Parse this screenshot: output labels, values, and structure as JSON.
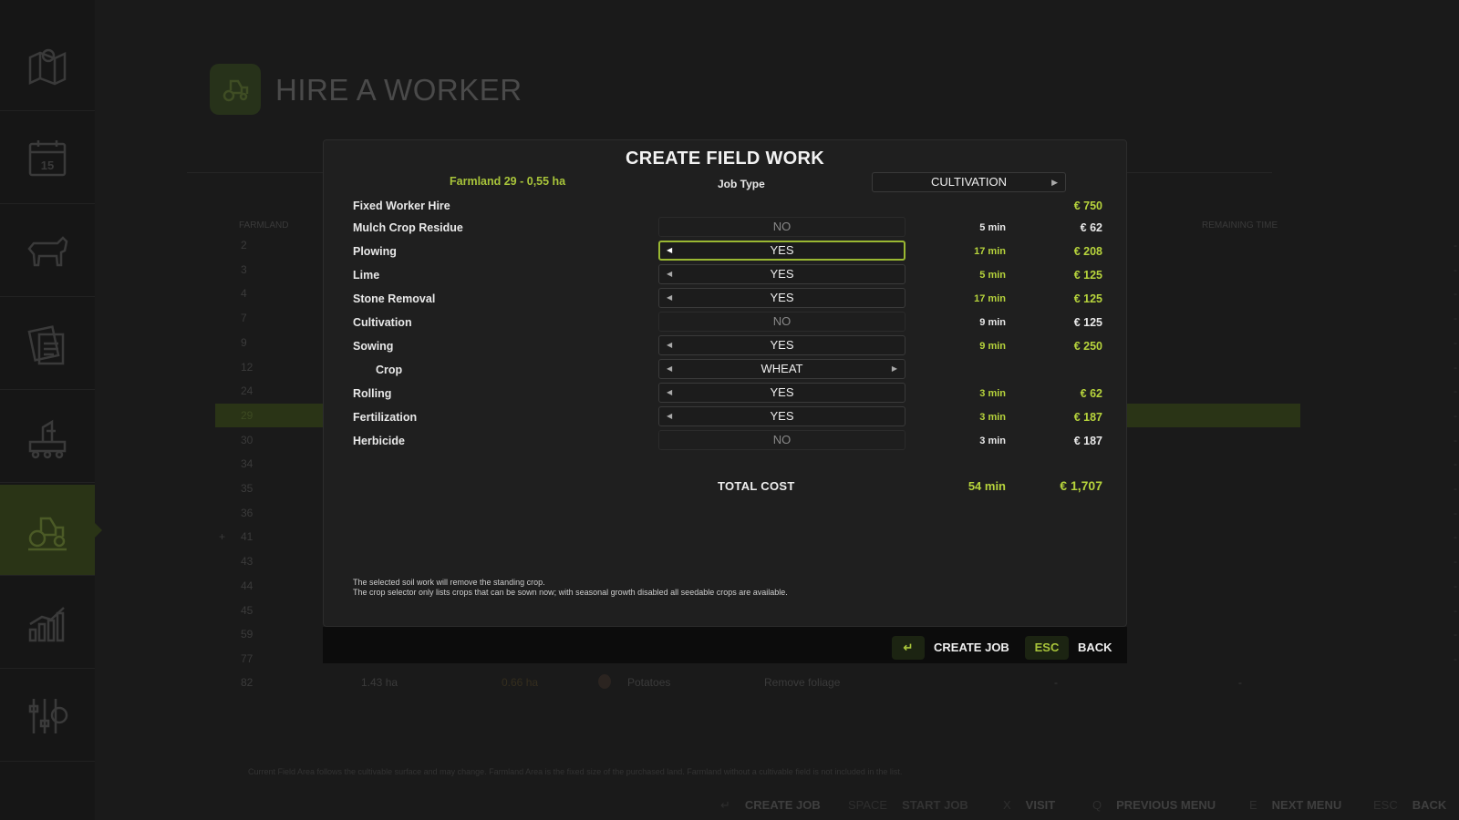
{
  "sidebar": {
    "items": [
      {
        "icon": "map-icon"
      },
      {
        "icon": "calendar-icon",
        "label": "15"
      },
      {
        "icon": "cow-icon"
      },
      {
        "icon": "contracts-icon"
      },
      {
        "icon": "production-icon"
      },
      {
        "icon": "tractor-icon",
        "active": true
      },
      {
        "icon": "statistics-icon"
      },
      {
        "icon": "settings-icon"
      }
    ]
  },
  "page": {
    "title": "HIRE A WORKER",
    "column_farmland": "FARMLAND",
    "column_remaining": "REMAINING TIME",
    "rows": [
      "2",
      "3",
      "4",
      "7",
      "9",
      "12",
      "24",
      "29",
      "30",
      "34",
      "35",
      "36",
      "41",
      "43",
      "44",
      "45",
      "59",
      "77",
      "82"
    ],
    "last_row": {
      "area": "1.43 ha",
      "area2": "0.66 ha",
      "crop": "Potatoes",
      "task": "Remove foliage"
    },
    "row_marker": "+",
    "empty": "-",
    "note": "Current Field Area follows the cultivable surface and may change. Farmland Area is the fixed size of the purchased land. Farmland without a cultivable field is not included in the list."
  },
  "footer": [
    {
      "key": "↵",
      "label": "CREATE JOB"
    },
    {
      "key": "SPACE",
      "label": "START JOB"
    },
    {
      "key": "X",
      "label": "VISIT"
    },
    {
      "key": "Q",
      "label": "PREVIOUS MENU"
    },
    {
      "key": "E",
      "label": "NEXT MENU"
    },
    {
      "key": "ESC",
      "label": "BACK"
    }
  ],
  "dialog": {
    "title": "CREATE FIELD WORK",
    "farmland": "Farmland 29 - 0,55 ha",
    "job_type_label": "Job Type",
    "job_type_value": "CULTIVATION",
    "fixed_hire_label": "Fixed Worker Hire",
    "fixed_hire_cost": "€ 750",
    "rows": [
      {
        "label": "Mulch Crop Residue",
        "value": "NO",
        "time": "5 min",
        "cost": "€ 62"
      },
      {
        "label": "Plowing",
        "value": "YES",
        "time": "17 min",
        "cost": "€ 208"
      },
      {
        "label": "Lime",
        "value": "YES",
        "time": "5 min",
        "cost": "€ 125"
      },
      {
        "label": "Stone Removal",
        "value": "YES",
        "time": "17 min",
        "cost": "€ 125"
      },
      {
        "label": "Cultivation",
        "value": "NO",
        "time": "9 min",
        "cost": "€ 125"
      },
      {
        "label": "Sowing",
        "value": "YES",
        "time": "9 min",
        "cost": "€ 250"
      },
      {
        "label": "Crop",
        "value": "WHEAT",
        "time": "",
        "cost": ""
      },
      {
        "label": "Rolling",
        "value": "YES",
        "time": "3 min",
        "cost": "€ 62"
      },
      {
        "label": "Fertilization",
        "value": "YES",
        "time": "3 min",
        "cost": "€ 187"
      },
      {
        "label": "Herbicide",
        "value": "NO",
        "time": "3 min",
        "cost": "€ 187"
      }
    ],
    "total_label": "TOTAL COST",
    "total_time": "54 min",
    "total_cost": "€ 1,707",
    "note1": "The selected soil work will remove the standing crop.",
    "note2": "The crop selector only lists crops that can be sown now; with seasonal growth disabled all seedable crops are available.",
    "create_key": "↵",
    "create_label": "CREATE JOB",
    "back_key": "ESC",
    "back_label": "BACK"
  },
  "colors": {
    "accent": "#b7d43c",
    "accent_dark": "#2a3416",
    "panel": "#1f1f1f"
  }
}
